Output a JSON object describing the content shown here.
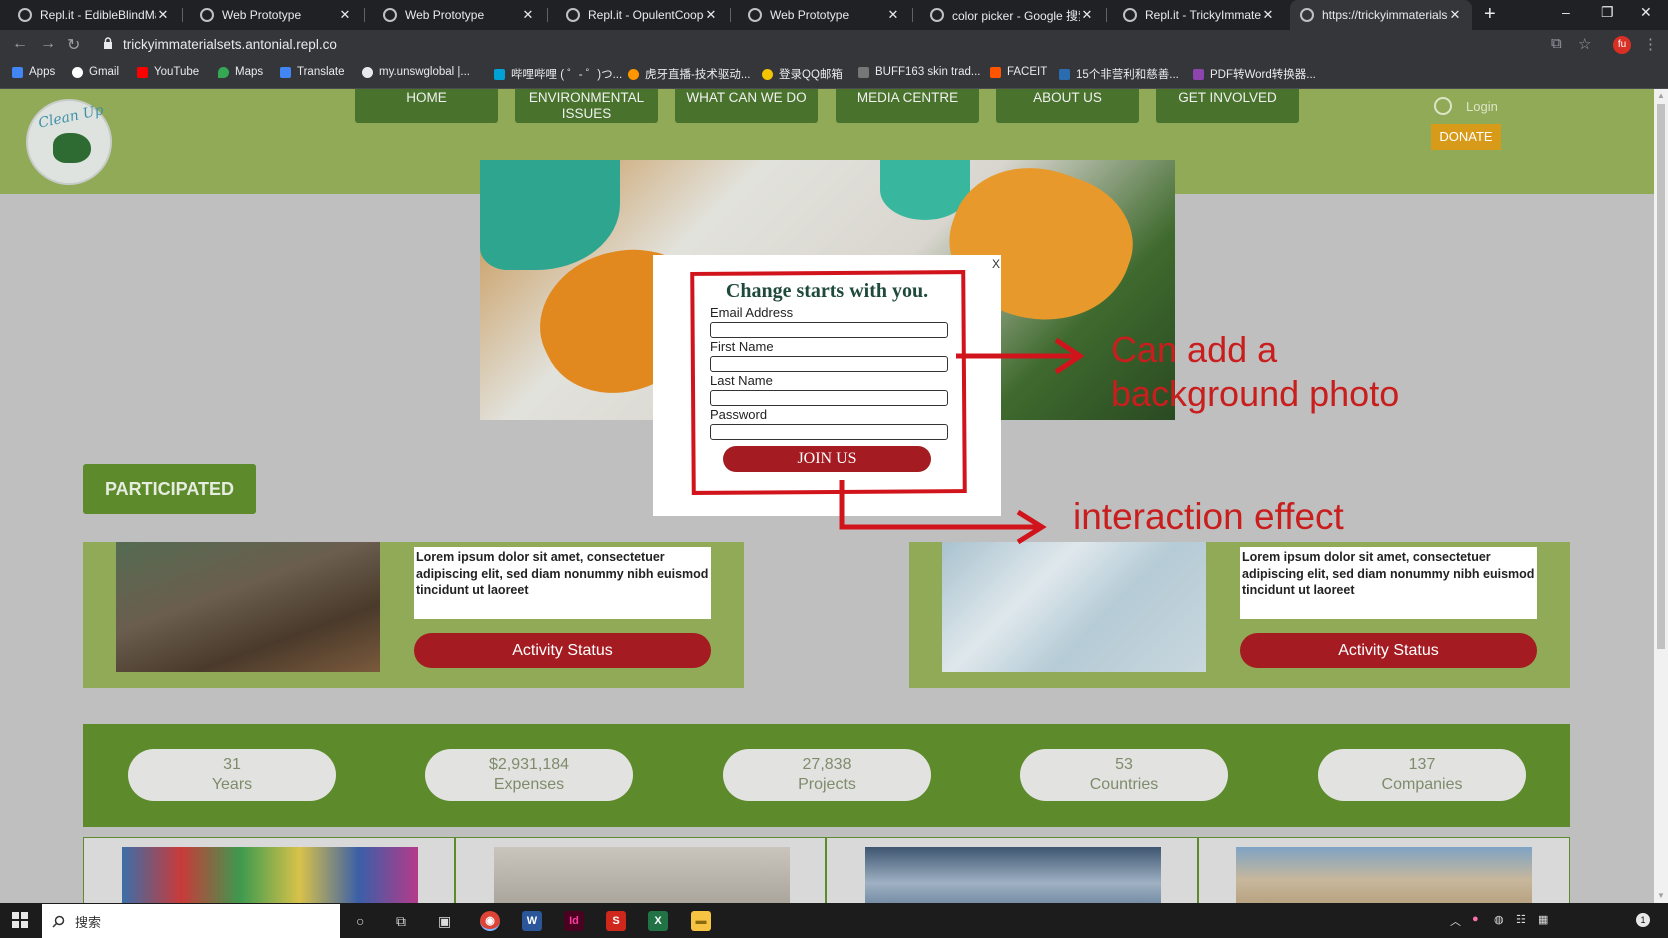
{
  "browser": {
    "tabs": [
      {
        "title": "Repl.it - EdibleBlindMana",
        "close": "✕"
      },
      {
        "title": "Web Prototype",
        "close": "✕"
      },
      {
        "title": "Web Prototype",
        "close": "✕"
      },
      {
        "title": "Repl.it - OpulentCooper",
        "close": "✕"
      },
      {
        "title": "Web Prototype",
        "close": "✕"
      },
      {
        "title": "color picker - Google 搜索",
        "close": "✕"
      },
      {
        "title": "Repl.it - TrickyImmaterial",
        "close": "✕"
      },
      {
        "title": "https://trickyimmaterialse",
        "close": "✕"
      }
    ],
    "new_tab": "+",
    "window_controls": {
      "minimize": "–",
      "restore": "❐",
      "close": "✕"
    },
    "url": "trickyimmaterialsets.antonial.repl.co",
    "profile_initials": "fu",
    "bookmarks": [
      {
        "label": "Apps",
        "color": "#4285f4"
      },
      {
        "label": "Gmail",
        "color": "#ffffff"
      },
      {
        "label": "YouTube",
        "color": "#ff0000"
      },
      {
        "label": "Maps",
        "color": "#34a853"
      },
      {
        "label": "Translate",
        "color": "#4285f4"
      },
      {
        "label": "my.unswglobal |...",
        "color": "#e8eaed"
      },
      {
        "label": "哔哩哔哩 ( ゜- ゜)つ...",
        "color": "#00a1d6"
      },
      {
        "label": "虎牙直播-技术驱动...",
        "color": "#ff9600"
      },
      {
        "label": "登录QQ邮箱",
        "color": "#f5c400"
      },
      {
        "label": "BUFF163 skin trad...",
        "color": "#777777"
      },
      {
        "label": "FACEIT",
        "color": "#ff5500"
      },
      {
        "label": "15个非营利和慈善...",
        "color": "#2b6cb0"
      },
      {
        "label": "PDF转Word转换器...",
        "color": "#8e44ad"
      }
    ]
  },
  "site": {
    "logo_text": "Clean Up",
    "nav": [
      {
        "label": "HOME"
      },
      {
        "label": "ENVIRONMENTAL ISSUES"
      },
      {
        "label": "WHAT CAN WE DO"
      },
      {
        "label": "MEDIA CENTRE"
      },
      {
        "label": "ABOUT US"
      },
      {
        "label": "GET INVOLVED"
      }
    ],
    "login": "Login",
    "donate": "DONATE",
    "participated": "PARTICIPATED",
    "cards": [
      {
        "text": "Lorem ipsum dolor sit amet, consectetuer adipiscing elit, sed diam nonummy nibh euismod tincidunt ut laoreet",
        "button": "Activity Status"
      },
      {
        "text": "Lorem ipsum dolor sit amet, consectetuer adipiscing elit, sed diam nonummy nibh euismod tincidunt ut laoreet",
        "button": "Activity Status"
      }
    ],
    "stats": [
      {
        "value": "31",
        "label": "Years"
      },
      {
        "value": "$2,931,184",
        "label": "Expenses"
      },
      {
        "value": "27,838",
        "label": "Projects"
      },
      {
        "value": "53",
        "label": "Countries"
      },
      {
        "value": "137",
        "label": "Companies"
      }
    ]
  },
  "modal": {
    "close": "X",
    "title": "Change starts with you.",
    "fields": [
      {
        "label": "Email Address",
        "value": ""
      },
      {
        "label": "First Name",
        "value": ""
      },
      {
        "label": "Last Name",
        "value": ""
      },
      {
        "label": "Password",
        "value": ""
      }
    ],
    "submit": "JOIN US"
  },
  "annotations": {
    "background_photo_line1": "Can add a",
    "background_photo_line2": "background photo",
    "interaction": "interaction effect",
    "color": "#c91e1e"
  },
  "taskbar": {
    "search_placeholder": "搜索",
    "apps": [
      {
        "name": "chrome",
        "glyph": "◉",
        "color": "#db4437"
      },
      {
        "name": "word",
        "glyph": "W",
        "color": "#2b579a"
      },
      {
        "name": "indesign",
        "glyph": "Id",
        "color": "#49021f"
      },
      {
        "name": "wps",
        "glyph": "S",
        "color": "#d0271d"
      },
      {
        "name": "excel",
        "glyph": "X",
        "color": "#217346"
      },
      {
        "name": "explorer",
        "glyph": "▬",
        "color": "#f6c343"
      }
    ],
    "notification_count": "1"
  }
}
